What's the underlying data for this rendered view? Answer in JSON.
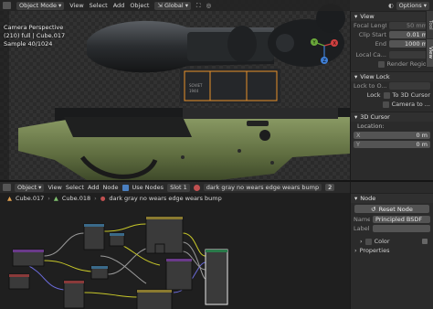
{
  "viewport": {
    "header": {
      "mode": "Object Mode",
      "menus": [
        "View",
        "Select",
        "Add",
        "Object"
      ],
      "transform": "Global",
      "options": "Options"
    },
    "info": {
      "line1": "Camera Perspective",
      "line2": "(210) full | Cube.017",
      "line3": "Sample 40/1024"
    },
    "gizmo_axes": [
      "Y",
      "X",
      "Z"
    ],
    "scene_labels": [
      "SOVIET",
      "1944"
    ]
  },
  "npanel": {
    "view_title": "View",
    "focal_label": "Focal Length",
    "focal_value": "50 mm",
    "clip_start_label": "Clip Start",
    "clip_start_value": "0.01 m",
    "end_label": "End",
    "end_value": "1000 m",
    "local_camera_label": "Local Ca...",
    "render_region_label": "Render Region",
    "view_lock_title": "View Lock",
    "lock_to_object_label": "Lock to O...",
    "lock_label": "Lock",
    "lock_3d_cursor": "To 3D Cursor",
    "camera_to_label": "Camera to ...",
    "cursor_title": "3D Cursor",
    "location_label": "Location:",
    "x_label": "X",
    "x_value": "0 m",
    "y_label": "Y",
    "y_value": "0 m",
    "tabs": [
      "Tool",
      "View"
    ]
  },
  "nodeeditor": {
    "header": {
      "type": "Object",
      "menus": [
        "View",
        "Select",
        "Add",
        "Node"
      ],
      "use_nodes_label": "Use Nodes",
      "slot": "Slot 1",
      "material": "dark gray no wears edge wears bump",
      "users": "2"
    },
    "breadcrumb": [
      "Cube.017",
      "Cube.018",
      "dark gray no wears edge wears bump"
    ]
  },
  "nodeside": {
    "node_title": "Node",
    "reset_label": "Reset Node",
    "name_label": "Name:",
    "name_value": "Principled BSDF",
    "label_label": "Label:",
    "label_value": "",
    "color_label": "Color",
    "properties_label": "Properties"
  },
  "colors": {
    "accent": "#4a7fbf",
    "selection_orange": "#e8902a",
    "stock_green": "#6b7a4a",
    "axis_x": "#d04040",
    "axis_y": "#6aa83a",
    "axis_z": "#3f7fd6"
  }
}
